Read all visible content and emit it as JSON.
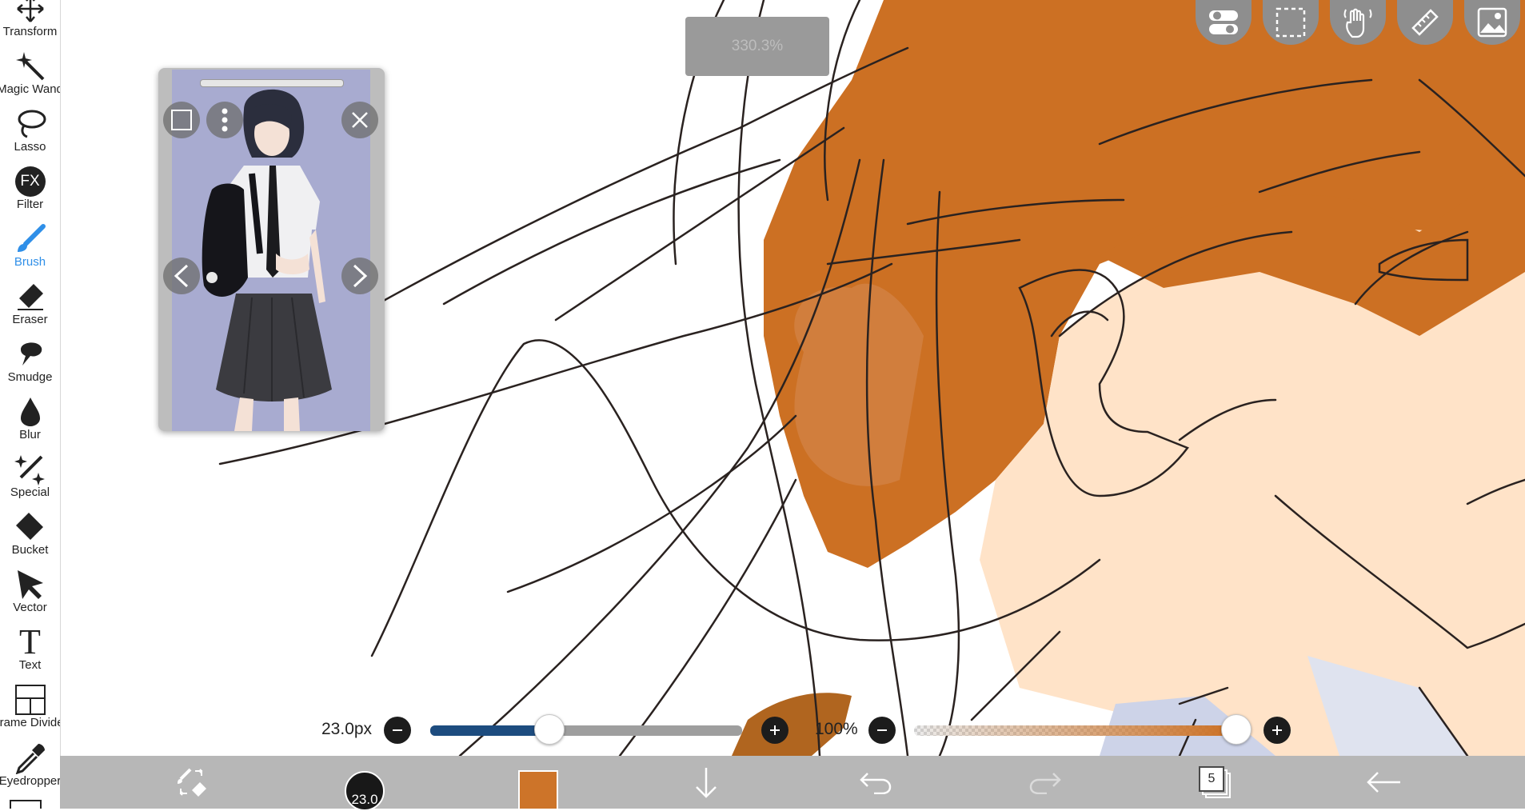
{
  "toolbar": {
    "items": [
      {
        "label": "Transform",
        "icon": "move-arrows-icon"
      },
      {
        "label": "Magic Wand",
        "icon": "magic-wand-icon"
      },
      {
        "label": "Lasso",
        "icon": "lasso-icon"
      },
      {
        "label": "Filter",
        "icon": "fx-icon",
        "glyph": "FX"
      },
      {
        "label": "Brush",
        "icon": "brush-icon",
        "active": true
      },
      {
        "label": "Eraser",
        "icon": "eraser-icon"
      },
      {
        "label": "Smudge",
        "icon": "smudge-icon"
      },
      {
        "label": "Blur",
        "icon": "blur-drop-icon"
      },
      {
        "label": "Special",
        "icon": "sparkle-pen-icon"
      },
      {
        "label": "Bucket",
        "icon": "bucket-icon"
      },
      {
        "label": "Vector",
        "icon": "vector-cursor-icon"
      },
      {
        "label": "Text",
        "icon": "text-t-icon",
        "glyph": "T"
      },
      {
        "label": "Frame Divider",
        "icon": "frame-divider-icon"
      },
      {
        "label": "Eyedropper",
        "icon": "eyedropper-icon"
      }
    ]
  },
  "canvas": {
    "zoom_label": "330.3%",
    "hair_color": "#cc7023",
    "skin_color": "#ffe3c8",
    "line_color": "#2a2220"
  },
  "reference_window": {
    "image_background": "#a8abd0"
  },
  "top_right_buttons": [
    "toggle-switch-icon",
    "selection-rect-icon",
    "hand-gesture-icon",
    "ruler-icon",
    "image-gallery-icon"
  ],
  "brush_size": {
    "label": "23.0px",
    "value": 23.0,
    "fraction": 0.38,
    "track_color": "#1d4c7f"
  },
  "opacity": {
    "label": "100%",
    "value": 100,
    "fraction": 1.0,
    "track_color": "#cc7023"
  },
  "bottom_bar": {
    "brush_preview_label": "23.0",
    "current_color": "#cc7023",
    "layer_count": "5"
  }
}
